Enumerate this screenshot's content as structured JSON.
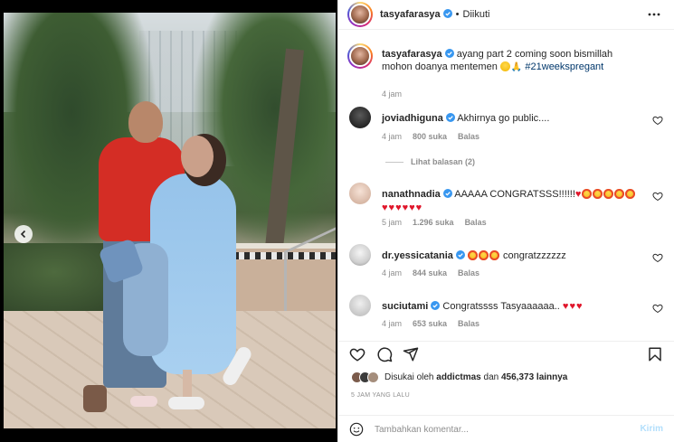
{
  "post": {
    "author": "tasyafarasya",
    "follow_status": "Diikuti",
    "caption_text": "ayang part 2 coming soon bismillah mohon doanya mentemen",
    "caption_hashtag": "#21weekspregant",
    "caption_time": "4 jam"
  },
  "comments": [
    {
      "user": "joviadhiguna",
      "text": "Akhirnya go public....",
      "time": "4 jam",
      "likes": "800 suka",
      "reply": "Balas"
    },
    {
      "user": "nanathnadia",
      "text": "AAAAA CONGRATSSS!!!!!!",
      "time": "5 jam",
      "likes": "1.296 suka",
      "reply": "Balas"
    },
    {
      "user": "dr.yessicatania",
      "text": "congratzzzzzz",
      "time": "4 jam",
      "likes": "844 suka",
      "reply": "Balas"
    },
    {
      "user": "suciutami",
      "text": "Congratssss Tasyaaaaaa..",
      "time": "4 jam",
      "likes": "653 suka",
      "reply": "Balas"
    }
  ],
  "view_replies": "Lihat balasan (2)",
  "likes": {
    "prefix": "Disukai oleh",
    "user": "addictmas",
    "middle": "dan",
    "count": "456,373 lainnya"
  },
  "timestamp": "5 JAM YANG LALU",
  "add_comment": {
    "placeholder": "Tambahkan komentar...",
    "post_label": "Kirim"
  },
  "icons": [
    "chevron-left-icon",
    "verified-badge-icon",
    "more-icon",
    "heart-icon",
    "comment-icon",
    "share-icon",
    "bookmark-icon",
    "emoji-icon"
  ],
  "colors": {
    "verified": "#3897f0",
    "link": "#00376b",
    "heart_emoji": "#e0162b",
    "post_disabled": "#b2dffc"
  }
}
